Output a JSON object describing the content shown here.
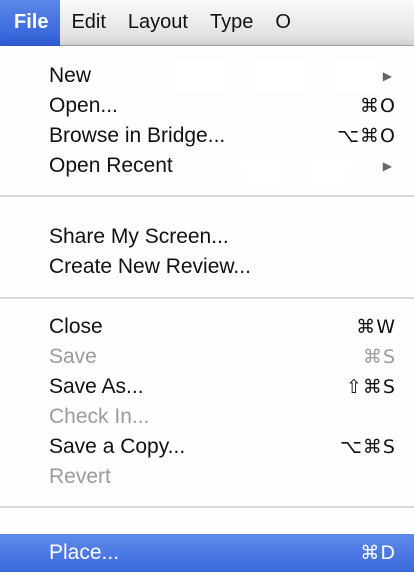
{
  "menubar": {
    "items": [
      {
        "label": "File",
        "active": true
      },
      {
        "label": "Edit"
      },
      {
        "label": "Layout"
      },
      {
        "label": "Type"
      },
      {
        "label": "O"
      }
    ]
  },
  "file_menu": {
    "groups": [
      [
        {
          "label": "New",
          "shortcut": "",
          "submenu": true,
          "enabled": true
        },
        {
          "label": "Open...",
          "shortcut": "⌘O",
          "enabled": true
        },
        {
          "label": "Browse in Bridge...",
          "shortcut": "⌥⌘O",
          "enabled": true
        },
        {
          "label": "Open Recent",
          "shortcut": "",
          "submenu": true,
          "enabled": true
        }
      ],
      [
        {
          "label": "Share My Screen...",
          "shortcut": "",
          "enabled": true
        },
        {
          "label": "Create New Review...",
          "shortcut": "",
          "enabled": true
        }
      ],
      [
        {
          "label": "Close",
          "shortcut": "⌘W",
          "enabled": true
        },
        {
          "label": "Save",
          "shortcut": "⌘S",
          "enabled": false
        },
        {
          "label": "Save As...",
          "shortcut": "⇧⌘S",
          "enabled": true
        },
        {
          "label": "Check In...",
          "shortcut": "",
          "enabled": false
        },
        {
          "label": "Save a Copy...",
          "shortcut": "⌥⌘S",
          "enabled": true
        },
        {
          "label": "Revert",
          "shortcut": "",
          "enabled": false
        }
      ],
      [
        {
          "label": "Place...",
          "shortcut": "⌘D",
          "enabled": true,
          "highlighted": true
        }
      ]
    ],
    "submenu_icon": "triangle-right-icon"
  },
  "colors": {
    "highlight": "#3b69dc",
    "disabled_text": "#9b9b9b"
  }
}
